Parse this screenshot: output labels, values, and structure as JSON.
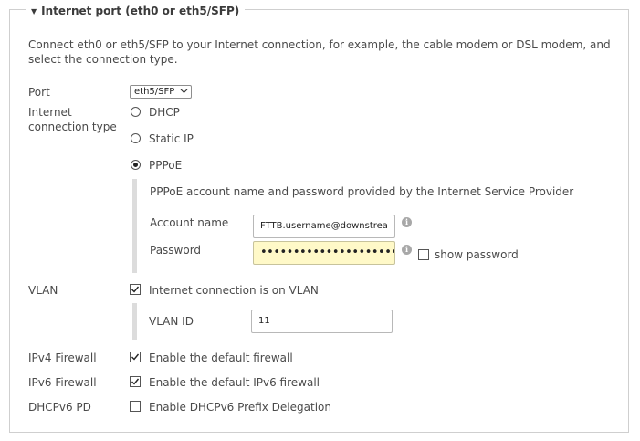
{
  "section": {
    "title": "Internet port (eth0 or eth5/SFP)",
    "description": "Connect eth0 or eth5/SFP to your Internet connection, for example, the cable modem or DSL modem, and select the connection type."
  },
  "port": {
    "label": "Port",
    "selected": "eth5/SFP"
  },
  "connection_type": {
    "label": "Internet connection type",
    "options": [
      {
        "label": "DHCP",
        "checked": false
      },
      {
        "label": "Static IP",
        "checked": false
      },
      {
        "label": "PPPoE",
        "checked": true
      }
    ]
  },
  "pppoe": {
    "note": "PPPoE account name and password provided by the Internet Service Provider",
    "account_label": "Account name",
    "account_value": "FTTB.username@downstrea",
    "password_label": "Password",
    "password_value": "••••••••••••••••••••••",
    "show_password_label": "show password",
    "show_password_checked": false
  },
  "vlan": {
    "label": "VLAN",
    "checkbox_label": "Internet connection is on VLAN",
    "checked": true,
    "id_label": "VLAN ID",
    "id_value": "11"
  },
  "ipv4_firewall": {
    "label": "IPv4 Firewall",
    "checkbox_label": "Enable the default firewall",
    "checked": true
  },
  "ipv6_firewall": {
    "label": "IPv6 Firewall",
    "checkbox_label": "Enable the default IPv6 firewall",
    "checked": true
  },
  "dhcpv6_pd": {
    "label": "DHCPv6 PD",
    "checkbox_label": "Enable DHCPv6 Prefix Delegation",
    "checked": false
  },
  "icons": {
    "collapse": "triangle-down-icon",
    "dropdown": "chevron-down-icon",
    "info": "info-icon",
    "check": "checkmark-icon"
  },
  "colors": {
    "password_bg": "#fff9c8",
    "border": "#cfcfcf",
    "accent_bar": "#dcdcdc"
  }
}
